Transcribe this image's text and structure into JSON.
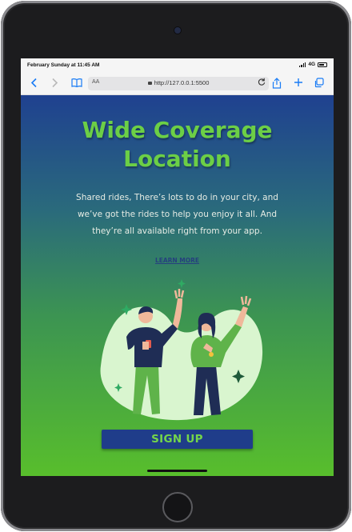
{
  "statusbar": {
    "time": "February Sunday at 11:45 AM",
    "network": "4G"
  },
  "browser": {
    "text_size_label": "AA",
    "url": "http://127.0.0.1:5500",
    "icons": [
      "back-icon",
      "forward-icon",
      "bookmarks-icon",
      "lock-icon",
      "reload-icon",
      "share-icon",
      "new-tab-icon",
      "tabs-icon"
    ]
  },
  "hero": {
    "title_line1": "Wide Coverage",
    "title_line2": "Location",
    "desc_line1": "Shared rides, There’s lots to do in your city, and",
    "desc_line2": "we’ve got the rides to help you enjoy it all. And",
    "desc_line3": "they’re all available right from your app.",
    "learn_more": "LEARN MORE",
    "signup_label": "SIGN UP"
  },
  "colors": {
    "gradient_top": "#1f4190",
    "gradient_bottom": "#58be2c",
    "title_green": "#6ccf46",
    "button_blue": "#1f3d8a",
    "browser_blue": "#1a7cf5"
  }
}
